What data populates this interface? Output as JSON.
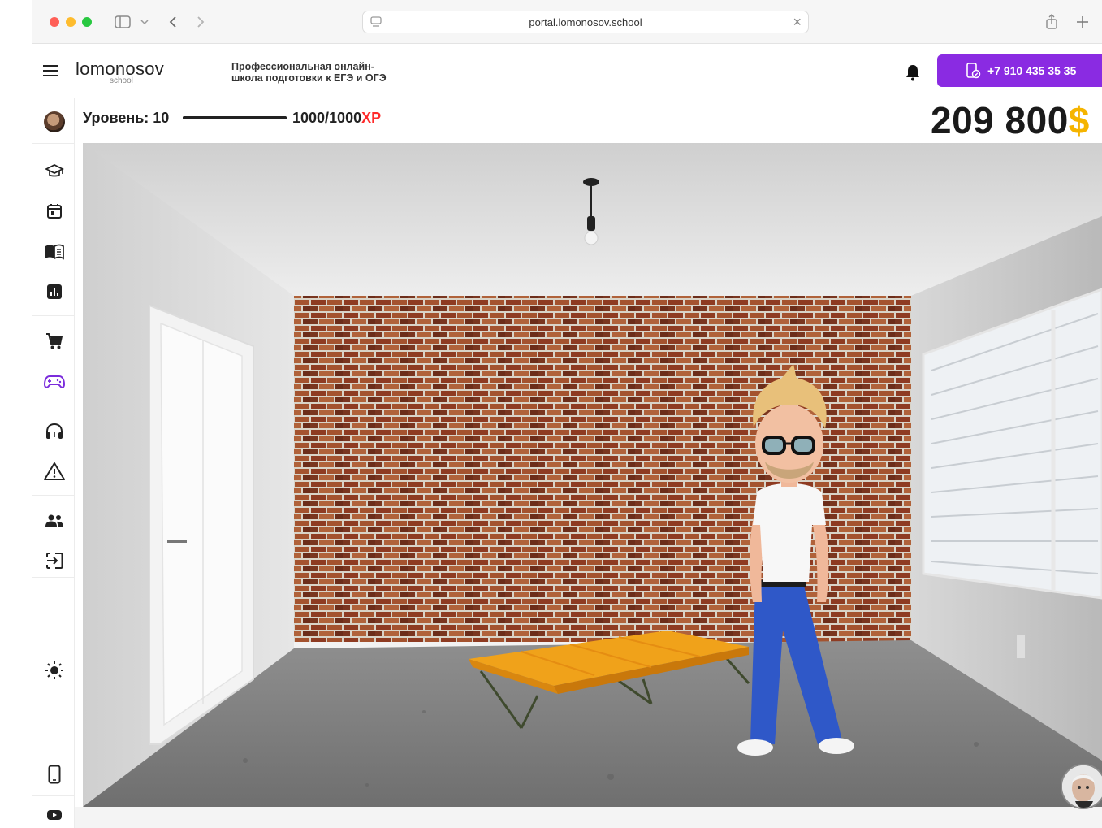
{
  "browser": {
    "url": "portal.lomonosov.school"
  },
  "header": {
    "logo_text": "lomonosov",
    "logo_sub": "school",
    "tagline_line1": "Профессиональная онлайн-",
    "tagline_line2": "школа подготовки к ЕГЭ и ОГЭ",
    "phone": "+7 910 435 35 35",
    "accent_color": "#8a2be2"
  },
  "level": {
    "label": "Уровень: 10",
    "xp_value": "1000/1000",
    "xp_unit": "XP",
    "progress": 1.0
  },
  "coins": {
    "value": "209 800"
  },
  "sidebar": {
    "items": [
      {
        "name": "courses-icon"
      },
      {
        "name": "calendar-icon"
      },
      {
        "name": "library-icon"
      },
      {
        "name": "stats-icon"
      },
      {
        "name": "shop-cart-icon"
      },
      {
        "name": "gamepad-icon"
      },
      {
        "name": "headphones-icon"
      },
      {
        "name": "warning-icon"
      },
      {
        "name": "people-icon"
      },
      {
        "name": "logout-icon"
      },
      {
        "name": "brightness-icon"
      },
      {
        "name": "phone-device-icon"
      },
      {
        "name": "youtube-icon"
      }
    ]
  }
}
